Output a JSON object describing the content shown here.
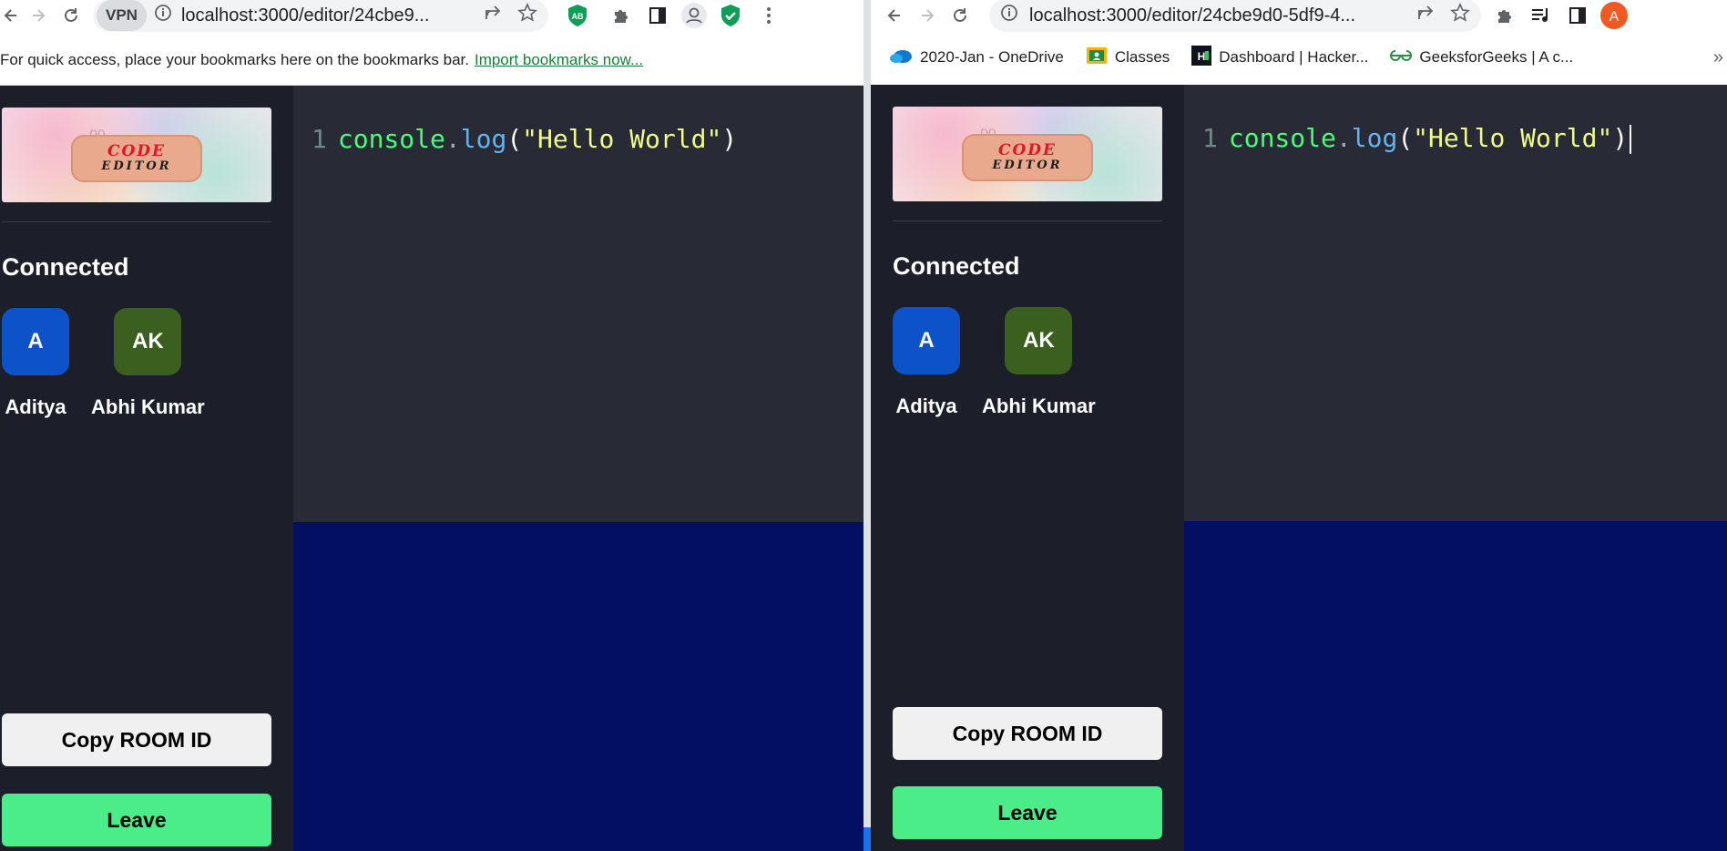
{
  "left_window": {
    "url": "localhost:3000/editor/24cbe9...",
    "vpn_label": "VPN",
    "bookmarks_hint": "For quick access, place your bookmarks here on the bookmarks bar.",
    "import_bookmarks": "Import bookmarks now...",
    "extension_badge": "AB",
    "sidebar": {
      "logo_top": "CODE",
      "logo_bottom": "EDITOR",
      "logo_hint": "DD",
      "connected_title": "Connected",
      "users": [
        {
          "initials": "A",
          "name": "Aditya",
          "color": "#0e52c9"
        },
        {
          "initials": "AK",
          "name": "Abhi Kumar",
          "color": "#3a5f1f"
        }
      ],
      "copy_button": "Copy ROOM ID",
      "leave_button": "Leave"
    },
    "editor": {
      "line_number": "1",
      "tok_object": "console",
      "tok_dot": ".",
      "tok_method": "log",
      "tok_open": "(",
      "tok_string": "\"Hello World\"",
      "tok_close": ")"
    }
  },
  "right_window": {
    "url": "localhost:3000/editor/24cbe9d0-5df9-4...",
    "profile_initial": "A",
    "bookmarks": [
      {
        "label": "2020-Jan - OneDrive",
        "icon": "onedrive-icon",
        "color": "#0f78d4"
      },
      {
        "label": "Classes",
        "icon": "classroom-icon",
        "color": "#f4b400"
      },
      {
        "label": "Dashboard | Hacker...",
        "icon": "hackerrank-icon",
        "color": "#0e141e"
      },
      {
        "label": "GeeksforGeeks | A c...",
        "icon": "gfg-icon",
        "color": "#2f8d46"
      }
    ],
    "sidebar": {
      "logo_top": "CODE",
      "logo_bottom": "EDITOR",
      "logo_hint": "DD",
      "connected_title": "Connected",
      "users": [
        {
          "initials": "A",
          "name": "Aditya",
          "color": "#0e52c9"
        },
        {
          "initials": "AK",
          "name": "Abhi Kumar",
          "color": "#3a5f1f"
        }
      ],
      "copy_button": "Copy ROOM ID",
      "leave_button": "Leave"
    },
    "editor": {
      "line_number": "1",
      "tok_object": "console",
      "tok_dot": ".",
      "tok_method": "log",
      "tok_open": "(",
      "tok_string": "\"Hello World\"",
      "tok_close": ")"
    }
  },
  "colors": {
    "sidebar_bg": "#1c1e29",
    "editor_bg": "#282a36",
    "output_bg": "#020f62",
    "leave_green": "#4aed88",
    "copy_gray": "#f0f0f0"
  }
}
